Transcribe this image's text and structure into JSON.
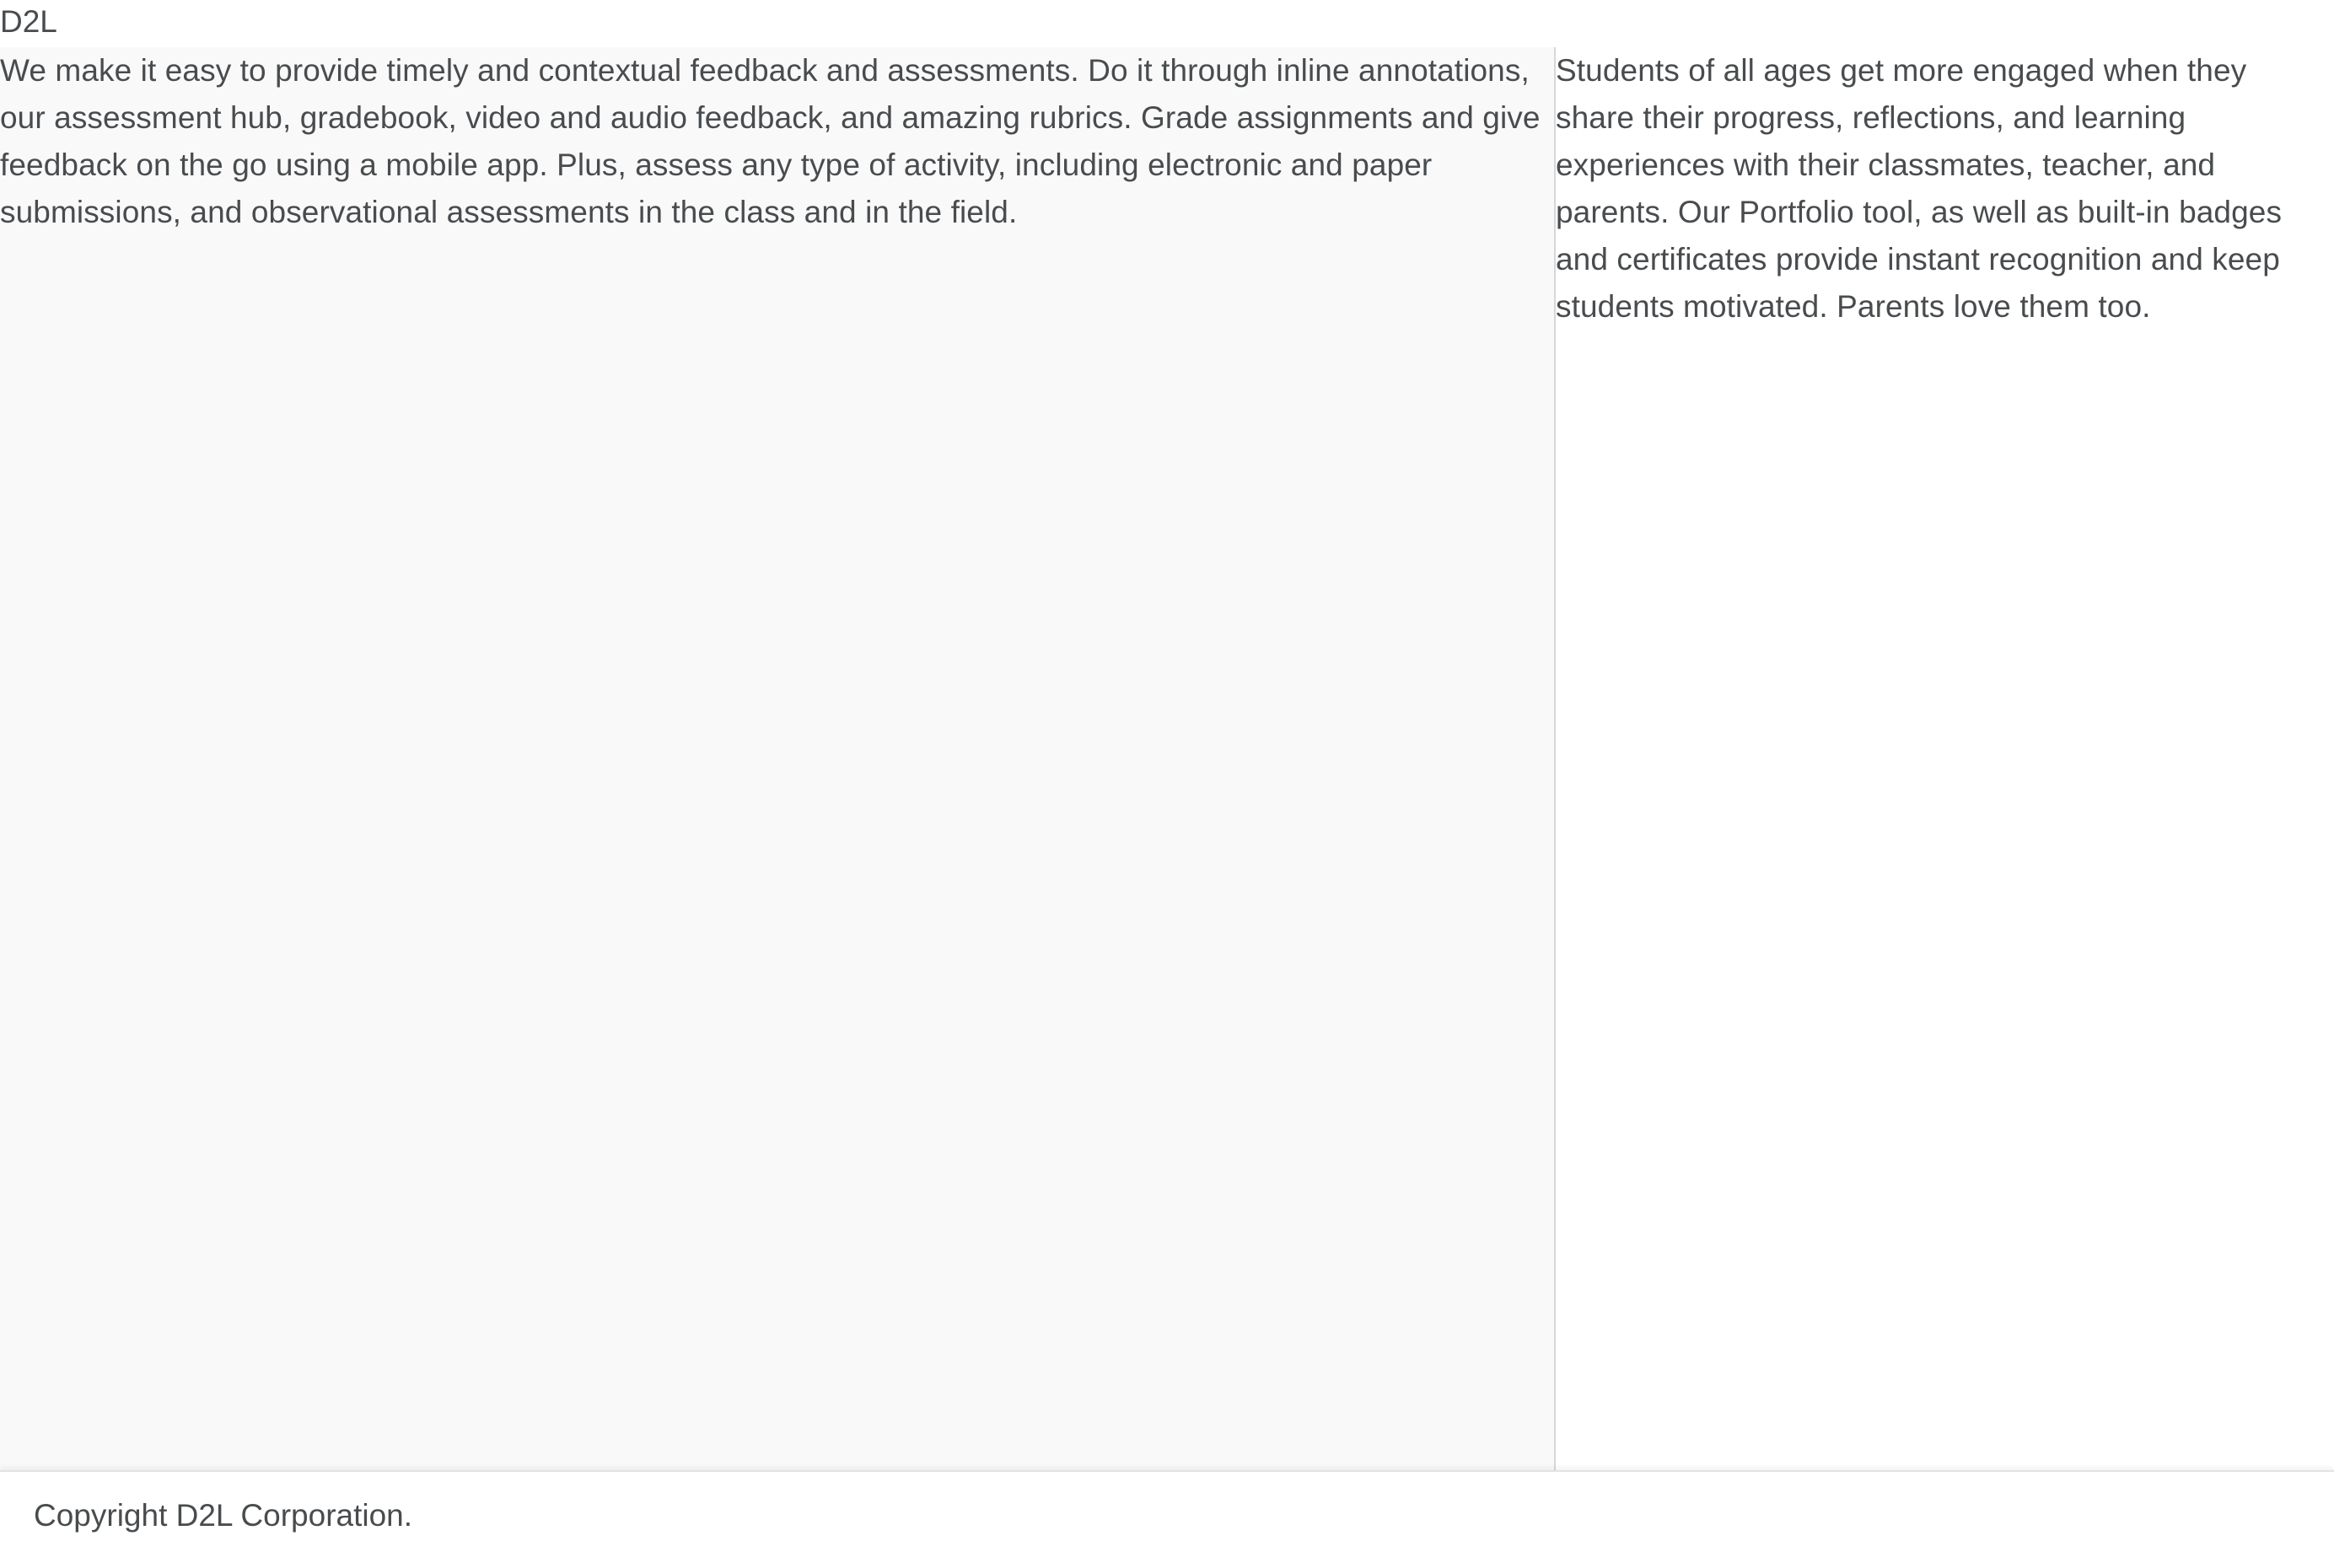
{
  "header": {
    "brand_text": "D2L"
  },
  "main": {
    "left_paragraph": "We make it easy to provide timely and contextual feedback and assessments. Do it through inline annotations, our assessment hub, gradebook, video and audio feedback, and amazing rubrics. Grade assignments and give feedback on the go using a mobile app. Plus, assess any type of activity, including electronic and paper submissions, and observational assessments in the class and in the field.",
    "right_paragraph": "Students of all ages get more engaged when they share their progress, reflections, and learning experiences with their classmates, teacher, and parents. Our Portfolio tool, as well as built-in badges and certificates provide instant recognition and keep students motivated. Parents love them too."
  },
  "footer": {
    "copyright": "Copyright D2L Corporation."
  },
  "colors": {
    "text": "#494c4e",
    "left_panel_bg": "#f9f9f9",
    "divider": "#d7d7d7",
    "background": "#ffffff"
  }
}
